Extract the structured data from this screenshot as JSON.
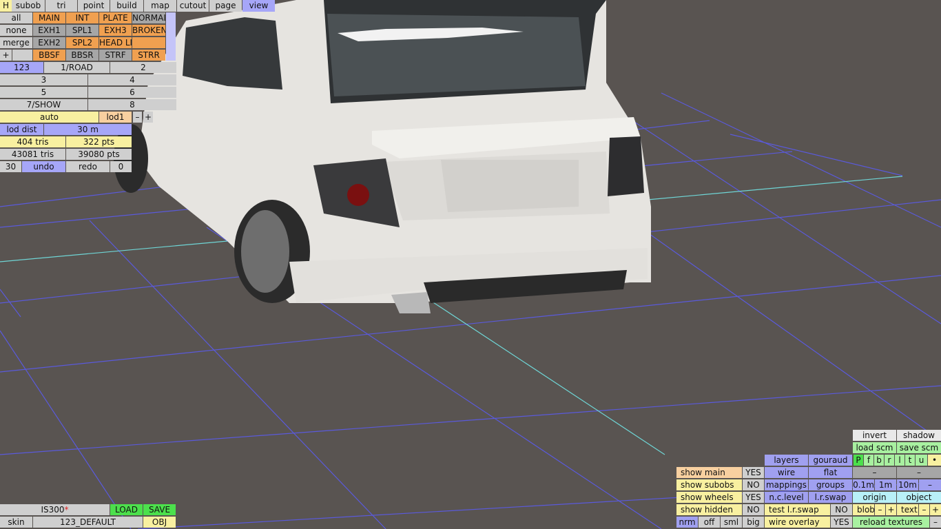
{
  "menu": {
    "tabs": [
      "H",
      "subob",
      "tri",
      "point",
      "build",
      "map",
      "cutout",
      "page",
      "view"
    ],
    "active": "view"
  },
  "layers": {
    "row1": [
      "all",
      "MAIN",
      "INT",
      "PLATE",
      "NORMAL"
    ],
    "row2": [
      "none",
      "EXH1",
      "SPL1",
      "EXH3",
      "BROKEN"
    ],
    "row3": [
      "merge",
      "EXH2",
      "SPL2",
      "HEAD LI",
      ""
    ],
    "row4": [
      "+",
      "",
      "BBSF",
      "BBSR",
      "STRF",
      "STRR"
    ]
  },
  "views": {
    "row1": [
      "123",
      "1/ROAD",
      "2"
    ],
    "row2": [
      "3",
      "4"
    ],
    "row3": [
      "5",
      "6"
    ],
    "row4": [
      "7/SHOW",
      "8"
    ]
  },
  "lod": {
    "auto": "auto",
    "level": "lod1",
    "minus": "–",
    "plus": "+",
    "dist_label": "lod dist",
    "dist_value": "30 m",
    "tris": "404 tris",
    "pts": "322 pts",
    "total_tris": "43081 tris",
    "total_pts": "39080 pts"
  },
  "undo": {
    "count": "30",
    "undo": "undo",
    "redo": "redo",
    "redo_count": "0"
  },
  "file": {
    "name": "IS300",
    "modified_mark": "*",
    "load": "LOAD",
    "save": "SAVE",
    "skin_label": "skin",
    "skin_value": "123_DEFAULT",
    "obj": "OBJ"
  },
  "display": {
    "invert": "invert",
    "shadow": "shadow",
    "load_scm": "load scm",
    "save_scm": "save scm",
    "flags": [
      "P",
      "f",
      "b",
      "r",
      "l",
      "t",
      "u",
      "•"
    ],
    "layers": "layers",
    "gouraud": "gouraud",
    "wire": "wire",
    "flat": "flat",
    "mappings": "mappings",
    "groups": "groups",
    "ncl": "n.c.level",
    "lrswap": "l.r.swap",
    "origin": "origin",
    "object": "object",
    "test_lrswap": "test l.r.swap",
    "test_val": "NO",
    "blob": "blob",
    "text": "text",
    "wire_overlay": "wire overlay",
    "wire_overlay_val": "YES",
    "reload": "reload textures",
    "dash": "–",
    "plus": "+",
    "steps": [
      "0.1m",
      "1m",
      "10m",
      "–"
    ]
  },
  "show": [
    {
      "label": "show main",
      "value": "YES"
    },
    {
      "label": "show subobs",
      "value": "NO"
    },
    {
      "label": "show wheels",
      "value": "YES"
    },
    {
      "label": "show hidden",
      "value": "NO"
    }
  ],
  "size_row": [
    "nrm",
    "off",
    "sml",
    "big"
  ],
  "colors": {
    "background": "#595451",
    "grid": "#5a5adc",
    "axis": "#6fd6d6",
    "body": "#e6e4e0"
  }
}
